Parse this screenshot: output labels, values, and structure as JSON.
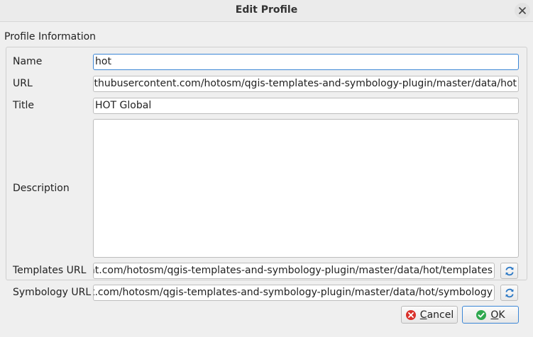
{
  "dialog": {
    "title": "Edit Profile"
  },
  "group": {
    "title": "Profile Information"
  },
  "fields": {
    "name_label": "Name",
    "name_value": "hot",
    "url_label": "URL",
    "url_value": "githubusercontent.com/hotosm/qgis-templates-and-symbology-plugin/master/data/hot",
    "title_label": "Title",
    "title_value": "HOT Global",
    "description_label": "Description",
    "description_value": "",
    "templates_url_label": "Templates URL",
    "templates_url_value": "nt.com/hotosm/qgis-templates-and-symbology-plugin/master/data/hot/templates",
    "symbology_url_label": "Symbology URL",
    "symbology_url_value": "nt.com/hotosm/qgis-templates-and-symbology-plugin/master/data/hot/symbology"
  },
  "buttons": {
    "cancel_mnemonic": "C",
    "cancel_rest": "ancel",
    "ok_mnemonic": "O",
    "ok_rest": "K"
  },
  "icons": {
    "close": "close-icon",
    "refresh": "refresh-icon",
    "cancel": "cancel-icon",
    "ok": "ok-icon"
  },
  "colors": {
    "focus_border": "#3b86d6",
    "cancel_icon": "#d9312b",
    "ok_icon": "#2fa84f",
    "refresh_icon": "#2b78c5"
  }
}
